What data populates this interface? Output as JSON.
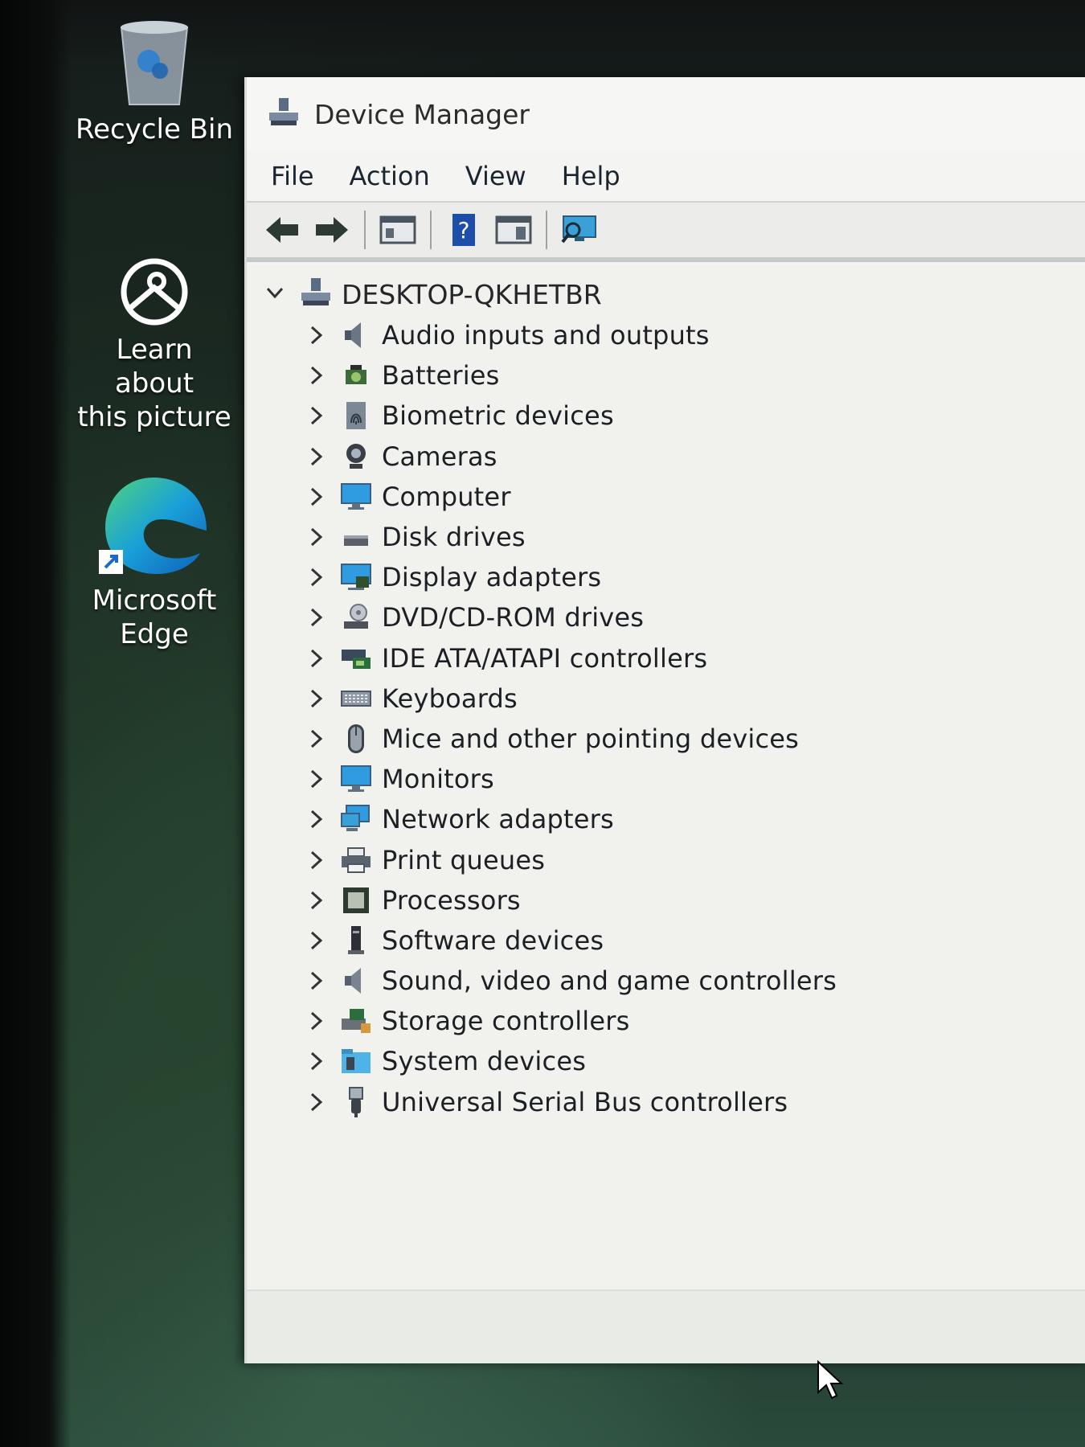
{
  "desktop": {
    "icons": [
      {
        "label_line1": "Recycle Bin",
        "label_line2": ""
      },
      {
        "label_line1": "Learn about",
        "label_line2": "this picture"
      },
      {
        "label_line1": "Microsoft",
        "label_line2": "Edge"
      }
    ]
  },
  "window": {
    "title": "Device Manager",
    "menu": [
      "File",
      "Action",
      "View",
      "Help"
    ],
    "toolbar": [
      "back-icon",
      "forward-icon",
      "properties-icon",
      "help-icon",
      "update-driver-icon",
      "scan-hardware-icon"
    ],
    "root": "DESKTOP-QKHETBR",
    "categories": [
      {
        "label": "Audio inputs and outputs",
        "icon": "speaker-icon"
      },
      {
        "label": "Batteries",
        "icon": "battery-icon"
      },
      {
        "label": "Biometric devices",
        "icon": "fingerprint-icon"
      },
      {
        "label": "Cameras",
        "icon": "camera-icon"
      },
      {
        "label": "Computer",
        "icon": "monitor-icon"
      },
      {
        "label": "Disk drives",
        "icon": "disk-drive-icon"
      },
      {
        "label": "Display adapters",
        "icon": "display-adapter-icon"
      },
      {
        "label": "DVD/CD-ROM drives",
        "icon": "dvd-drive-icon"
      },
      {
        "label": "IDE ATA/ATAPI controllers",
        "icon": "ide-controller-icon"
      },
      {
        "label": "Keyboards",
        "icon": "keyboard-icon"
      },
      {
        "label": "Mice and other pointing devices",
        "icon": "mouse-icon"
      },
      {
        "label": "Monitors",
        "icon": "monitor-icon"
      },
      {
        "label": "Network adapters",
        "icon": "network-adapter-icon"
      },
      {
        "label": "Print queues",
        "icon": "printer-icon"
      },
      {
        "label": "Processors",
        "icon": "processor-icon"
      },
      {
        "label": "Software devices",
        "icon": "software-device-icon"
      },
      {
        "label": "Sound, video and game controllers",
        "icon": "sound-icon"
      },
      {
        "label": "Storage controllers",
        "icon": "storage-controller-icon"
      },
      {
        "label": "System devices",
        "icon": "system-folder-icon"
      },
      {
        "label": "Universal Serial Bus controllers",
        "icon": "usb-icon"
      }
    ]
  }
}
